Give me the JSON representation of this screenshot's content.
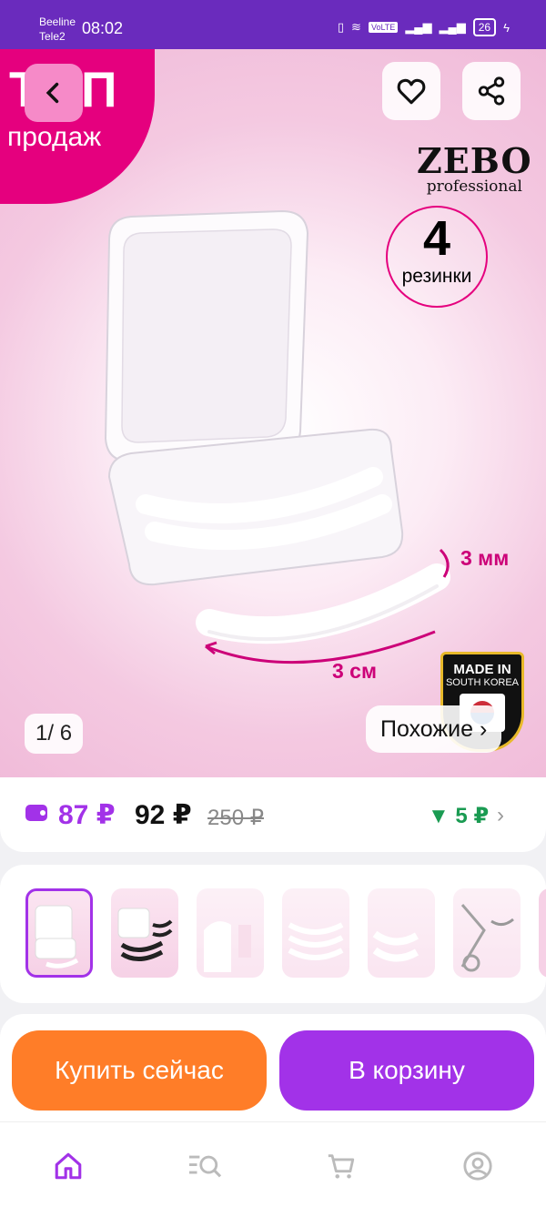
{
  "status_bar": {
    "carrier_1": "Beeline",
    "carrier_2": "Tele2",
    "time": "08:02",
    "volte": "VoLTE",
    "battery": "26"
  },
  "hero": {
    "badge_main": "ТОП",
    "badge_sub": "продаж",
    "brand_name": "ZEBO",
    "brand_sub": "professional",
    "bands_count": "4",
    "bands_word": "резинки",
    "dimension_thickness": "3 мм",
    "dimension_length": "3 см",
    "origin_main": "MADE IN",
    "origin_sub": "SOUTH KOREA",
    "counter_current": "1",
    "counter_total": "/ 6",
    "similar_label": "Похожие ›"
  },
  "icons": {
    "back": "chevron-left-icon",
    "favorite": "heart-icon",
    "share": "share-icon",
    "wallet": "wallet-icon",
    "cashback": "triangle-down-icon",
    "chevron": "chevron-right-icon"
  },
  "price": {
    "wallet_price": "87 ₽",
    "current_price": "92 ₽",
    "old_price": "250 ₽",
    "cashback": "▼ 5 ₽",
    "chevron": "›"
  },
  "gallery": {
    "selected_index": 1,
    "thumbnail_count": 6
  },
  "actions": {
    "buy_now": "Купить сейчас",
    "add_to_cart": "В корзину"
  },
  "nav": {
    "items": [
      "home-icon",
      "catalog-search-icon",
      "cart-icon",
      "profile-icon"
    ]
  },
  "colors": {
    "accent": "#a232e8",
    "buy": "#ff7d28",
    "status_bar": "#6a2bbd",
    "badge": "#e5007e",
    "cashback": "#1a9b52"
  }
}
